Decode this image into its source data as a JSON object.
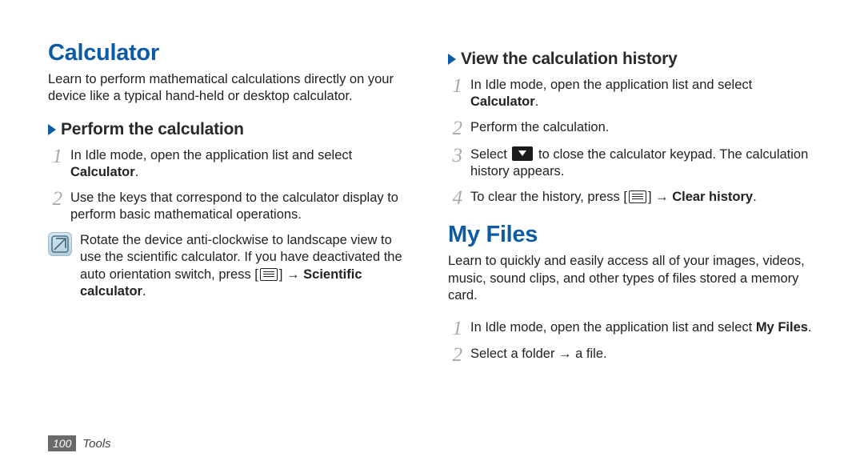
{
  "footer": {
    "page_number": "100",
    "section": "Tools"
  },
  "left": {
    "h1": "Calculator",
    "intro": "Learn to perform mathematical calculations directly on your device like a typical hand-held or desktop calculator.",
    "sub1": "Perform the calculation",
    "step1_a": "In Idle mode, open the application list and select ",
    "step1_b": "Calculator",
    "step1_c": ".",
    "step2": "Use the keys that correspond to the calculator display to perform basic mathematical operations.",
    "note_a": "Rotate the device anti-clockwise to landscape view to use the scientific calculator. If you have deactivated the auto orientation switch, press [",
    "note_b": "] → ",
    "note_c": "Scientific calculator",
    "note_d": "."
  },
  "right": {
    "sub1": "View the calculation history",
    "r1_a": "In Idle mode, open the application list and select ",
    "r1_b": "Calculator",
    "r1_c": ".",
    "r2": "Perform the calculation.",
    "r3_a": "Select ",
    "r3_b": " to close the calculator keypad. The calculation history appears.",
    "r4_a": "To clear the history, press [",
    "r4_b": "] → ",
    "r4_c": "Clear history",
    "r4_d": ".",
    "h2": "My Files",
    "intro2": "Learn to quickly and easily access all of your images, videos, music, sound clips, and other types of files stored a memory card.",
    "mf1_a": "In Idle mode, open the application list and select ",
    "mf1_b": "My Files",
    "mf1_c": ".",
    "mf2": "Select a folder → a file."
  }
}
